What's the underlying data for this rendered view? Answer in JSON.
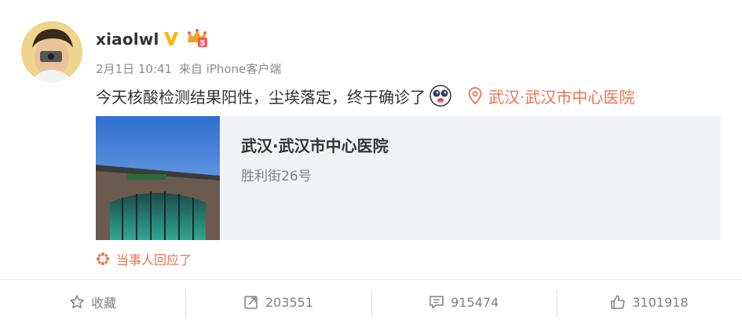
{
  "post": {
    "username": "xiaolwl",
    "meta": {
      "date": "2月1日 10:41",
      "source": "来自 iPhone客户端"
    },
    "content_text": "今天核酸检测结果阳性，尘埃落定，终于确诊了",
    "location": "武汉·武汉市中心医院",
    "card": {
      "title": "武汉·武汉市中心医院",
      "subtitle": "胜利街26号"
    },
    "reply_note": "当事人回应了"
  },
  "actions": {
    "favorite": "收藏",
    "repost_count": "203551",
    "comment_count": "915474",
    "like_count": "3101918"
  },
  "colors": {
    "accent": "#eb7350",
    "verified": "#ffb400"
  },
  "icons": {
    "verified": "verified-v-icon",
    "vip": "vip-crown-icon",
    "location": "location-pin-icon",
    "reply": "reply-star-icon",
    "favorite": "star-icon",
    "repost": "repost-icon",
    "comment": "comment-icon",
    "like": "thumbs-up-icon"
  }
}
